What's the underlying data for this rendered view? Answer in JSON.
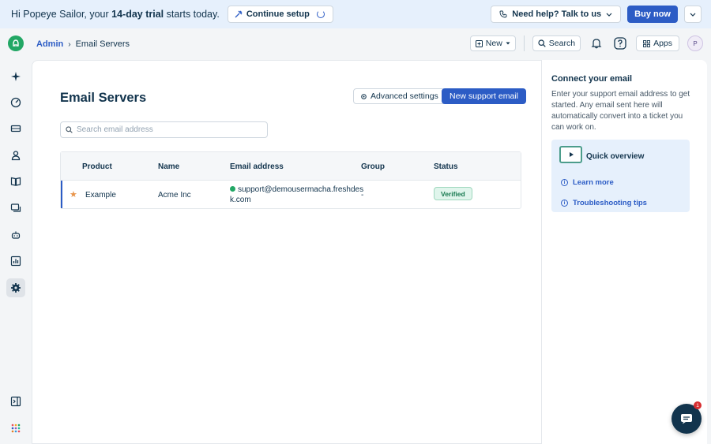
{
  "banner": {
    "greeting_prefix": "Hi Popeye Sailor, your ",
    "trial_bold": "14-day trial",
    "greeting_suffix": " starts today.",
    "continue_label": "Continue setup",
    "help_label": "Need help? Talk to us",
    "buy_label": "Buy now"
  },
  "breadcrumb": {
    "root": "Admin",
    "separator": "›",
    "current": "Email Servers"
  },
  "topbar": {
    "new_label": "New",
    "search_label": "Search",
    "apps_label": "Apps",
    "avatar_initial": "P"
  },
  "main": {
    "title": "Email Servers",
    "advanced_label": "Advanced settings",
    "new_support_label": "New support email",
    "search_placeholder": "Search email address"
  },
  "table": {
    "columns": [
      "Product",
      "Name",
      "Email address",
      "Group",
      "Status"
    ],
    "rows": [
      {
        "product": "Example",
        "name": "Acme Inc",
        "email_line1": "support@demousermacha.freshdes",
        "email_line2": "k.com",
        "group": "-",
        "status": "Verified"
      }
    ]
  },
  "rpanel": {
    "title": "Connect your email",
    "text": "Enter your support email address to get started. Any email sent here will automatically convert into a ticket you can work on.",
    "quick_overview": "Quick overview",
    "learn_more": "Learn more",
    "troubleshooting": "Troubleshooting tips"
  },
  "chat": {
    "badge_count": "1"
  },
  "colors": {
    "accent": "#2c5cc5",
    "brand_green": "#22a765",
    "banner_bg": "#e6f0fc",
    "verified_bg": "#e0f5ec"
  },
  "nav_icons": [
    "sparkle-icon",
    "dashboard-icon",
    "tickets-icon",
    "contacts-icon",
    "solutions-icon",
    "forums-icon",
    "bot-icon",
    "reports-icon",
    "admin-gear-icon",
    "expand-panel-icon",
    "product-grid-icon"
  ]
}
